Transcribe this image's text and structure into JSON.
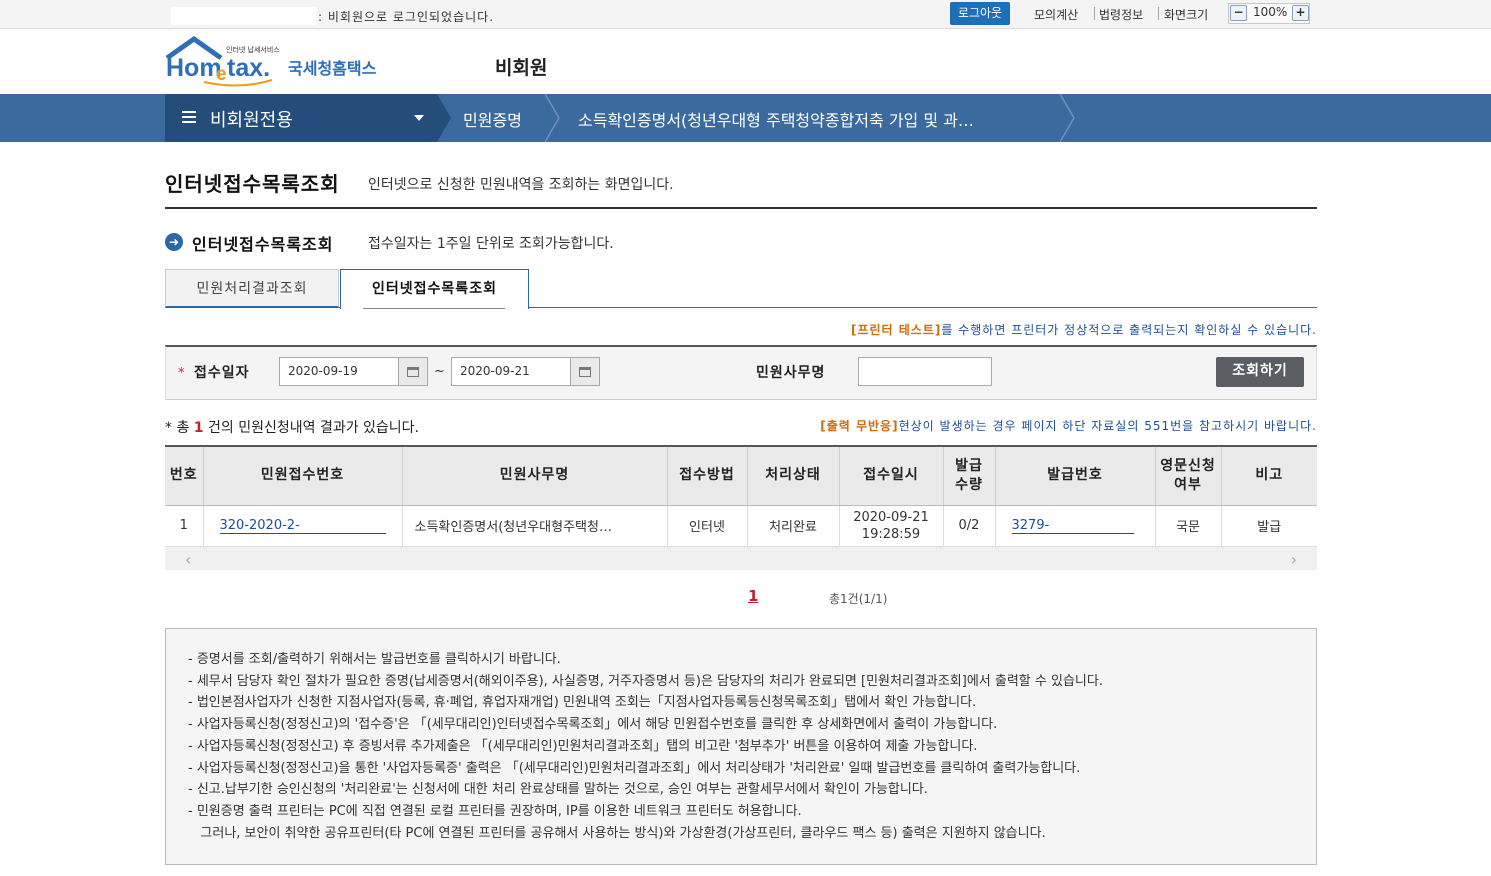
{
  "topbar": {
    "login_msg": ": 비회원으로 로그인되었습니다.",
    "logout": "로그아웃",
    "links": [
      "모의계산",
      "법령정보",
      "화면크기"
    ],
    "zoom": "100%"
  },
  "header": {
    "logo_tagline": "인터넷 납세서비스",
    "logo_home": "Hom",
    "logo_e": "e",
    "logo_tax": "tax.",
    "logo_kr": "국세청홈택스",
    "user_title": "비회원"
  },
  "nav": {
    "menu": "비회원전용",
    "crumb1": "민원증명",
    "crumb2": "소득확인증명서(청년우대형 주택청약종합저축 가입 및 과…"
  },
  "page": {
    "title": "인터넷접수목록조회",
    "desc": "인터넷으로 신청한 민원내역을 조회하는 화면입니다.",
    "sub_title": "인터넷접수목록조회",
    "sub_desc": "접수일자는 1주일 단위로 조회가능합니다."
  },
  "tabs": [
    "민원처리결과조회",
    "인터넷접수목록조회"
  ],
  "printer_note": {
    "hl": "[프린터 테스트]",
    "rest": "를 수행하면 프린터가 정상적으로 출력되는지 확인하실 수 있습니다."
  },
  "search": {
    "star": "*",
    "date_label": "접수일자",
    "from": "2020-09-19",
    "tilde": "~",
    "to": "2020-09-21",
    "name_label": "민원사무명",
    "name_value": "",
    "btn": "조회하기"
  },
  "result": {
    "prefix": "* 총",
    "count": "1",
    "suffix": "건의 민원신청내역 결과가 있습니다.",
    "err_hl": "[출력 무반응]",
    "err_rest": "현상이 발생하는 경우 페이지 하단 자료실의 551번을 참고하시기 바랍니다."
  },
  "table": {
    "headers": [
      "번호",
      "민원접수번호",
      "민원사무명",
      "접수방법",
      "처리상태",
      "접수일시",
      "발급\n수량",
      "발급번호",
      "영문신청\n여부",
      "비고"
    ],
    "rows": [
      {
        "no": "1",
        "receipt_no": "320-2020-2-",
        "name": "소득확인증명서(청년우대형주택청…",
        "method": "인터넷",
        "status": "처리완료",
        "date": "2020-09-21",
        "time": "19:28:59",
        "qty": "0/2",
        "issue_no": "3279-",
        "lang": "국문",
        "note": "발급"
      }
    ]
  },
  "pager": {
    "current": "1",
    "total": "총1건(1/1)"
  },
  "notice": [
    "- 증명서를 조회/출력하기 위해서는 발급번호를 클릭하시기 바랍니다.",
    "- 세무서 담당자 확인 절차가 필요한 증명(납세증명서(해외이주용), 사실증명, 거주자증명서 등)은 담당자의 처리가 완료되면 [민원처리결과조회]에서 출력할 수 있습니다.",
    "- 법인본점사업자가 신청한 지점사업자(등록, 휴·폐업, 휴업자재개업) 민원내역 조회는「지점사업자등록등신청목록조회」탭에서 확인 가능합니다.",
    "- 사업자등록신청(정정신고)의 '접수증'은 「(세무대리인)인터넷접수목록조회」에서 해당 민원접수번호를 클릭한 후 상세화면에서 출력이 가능합니다.",
    "- 사업자등록신청(정정신고) 후 증빙서류 추가제출은 「(세무대리인)민원처리결과조회」탭의 비고란 '첨부추가' 버튼을 이용하여 제출 가능합니다.",
    "- 사업자등록신청(정정신고)을 통한 '사업자등록증' 출력은 「(세무대리인)민원처리결과조회」에서 처리상태가 '처리완료' 일때 발급번호를 클릭하여 출력가능합니다.",
    "- 신고.납부기한 승인신청의 '처리완료'는 신청서에 대한 처리 완료상태를 말하는 것으로, 승인 여부는 관할세무서에서 확인이 가능합니다.",
    "- 민원증명 출력 프린터는 PC에 직접 연결된 로컬 프린터를 권장하며, IP를 이용한 네트워크 프린터도 허용합니다.",
    "   그러나, 보안이 취약한 공유프린터(타 PC에 연결된 프린터를 공유해서 사용하는 방식)와 가상환경(가상프린터, 클라우드 팩스 등) 출력은 지원하지 않습니다."
  ],
  "colors": {
    "nav": "#3b6a9e",
    "nav_dark": "#244d7c",
    "accent": "#2b68a8",
    "red": "#c8202a",
    "orange": "#d06a0c"
  }
}
